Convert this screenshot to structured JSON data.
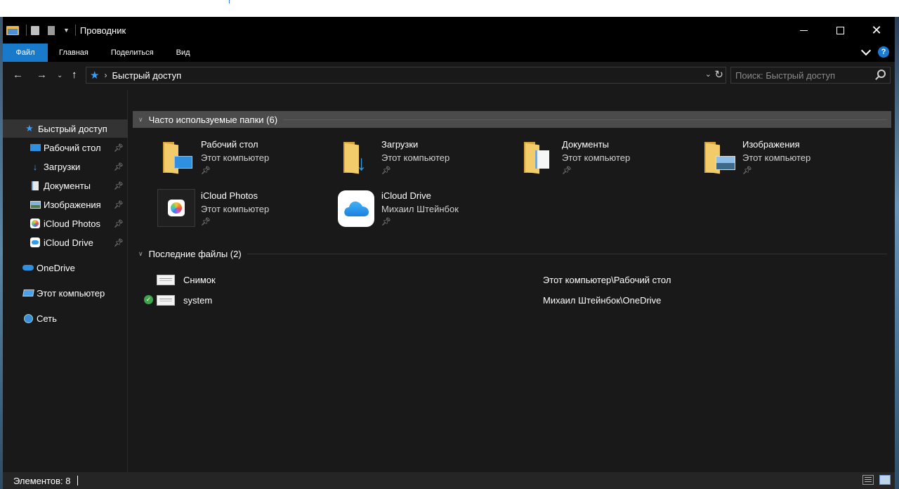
{
  "window": {
    "title": "Проводник",
    "min_icon": "minimize-icon",
    "max_icon": "maximize-icon",
    "close_icon": "close-icon"
  },
  "ribbon": {
    "tabs": [
      "Файл",
      "Главная",
      "Поделиться",
      "Вид"
    ],
    "help_label": "?",
    "accent": "#1979ca"
  },
  "nav": {
    "path": "Быстрый доступ",
    "search_placeholder": "Поиск: Быстрый доступ"
  },
  "sidebar": {
    "items": [
      {
        "label": "Быстрый доступ",
        "icon": "star-icon"
      },
      {
        "label": "Рабочий стол",
        "icon": "desktop-icon",
        "pinned": true
      },
      {
        "label": "Загрузки",
        "icon": "download-icon",
        "pinned": true
      },
      {
        "label": "Документы",
        "icon": "document-icon",
        "pinned": true
      },
      {
        "label": "Изображения",
        "icon": "pictures-icon",
        "pinned": true
      },
      {
        "label": "iCloud Photos",
        "icon": "icloud-photos-icon",
        "pinned": true
      },
      {
        "label": "iCloud Drive",
        "icon": "icloud-drive-icon",
        "pinned": true
      },
      {
        "label": "OneDrive",
        "icon": "onedrive-icon"
      },
      {
        "label": "Этот компьютер",
        "icon": "computer-icon"
      },
      {
        "label": "Сеть",
        "icon": "network-icon"
      }
    ]
  },
  "frequent": {
    "header": "Часто используемые папки (6)",
    "folders": [
      {
        "name": "Рабочий стол",
        "location": "Этот компьютер"
      },
      {
        "name": "Загрузки",
        "location": "Этот компьютер"
      },
      {
        "name": "Документы",
        "location": "Этот компьютер"
      },
      {
        "name": "Изображения",
        "location": "Этот компьютер"
      },
      {
        "name": "iCloud Photos",
        "location": "Этот компьютер"
      },
      {
        "name": "iCloud Drive",
        "location": "Михаил Штейнбок"
      }
    ]
  },
  "recent": {
    "header": "Последние файлы (2)",
    "files": [
      {
        "name": "Снимок",
        "path": "Этот компьютер\\Рабочий стол",
        "synced": false
      },
      {
        "name": "system",
        "path": "Михаил Штейнбок\\OneDrive",
        "synced": true
      }
    ]
  },
  "status": {
    "items_text": "Элементов: 8"
  }
}
